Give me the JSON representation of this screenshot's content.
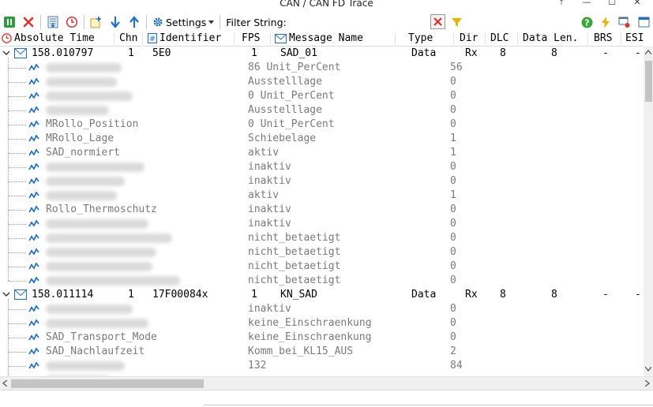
{
  "window": {
    "title": "CAN / CAN FD Trace",
    "buttons": [
      "⤒",
      "—",
      "☐",
      "✕"
    ]
  },
  "toolbar": {
    "settings_label": "Settings",
    "filter_label": "Filter String:",
    "filter_value": ""
  },
  "columns": {
    "time": "Absolute Time",
    "chn": "Chn",
    "identifier": "Identifier",
    "fps": "FPS",
    "message_name": "Message Name",
    "type": "Type",
    "dir": "Dir",
    "dlc": "DLC",
    "data_len": "Data Len.",
    "brs": "BRS",
    "esi": "ESI"
  },
  "messages": [
    {
      "time": "158.010797",
      "chn": "1",
      "id": "5E0",
      "fps": "1",
      "name": "SAD_01",
      "type": "Data",
      "dir": "Rx",
      "dlc": "8",
      "data_len": "8",
      "brs": "-",
      "esi": "-",
      "signals": [
        {
          "name": "",
          "value": "86 Unit_PerCent",
          "raw": "56",
          "blur": 96
        },
        {
          "name": "",
          "value": "Ausstelllage",
          "raw": "0",
          "blur": 90
        },
        {
          "name": "",
          "value": "0 Unit_PerCent",
          "raw": "0",
          "blur": 110
        },
        {
          "name": "",
          "value": "Ausstelllage",
          "raw": "0",
          "blur": 80
        },
        {
          "name": "MRollo_Position",
          "value": "0 Unit_PerCent",
          "raw": "0",
          "blur": 0
        },
        {
          "name": "MRollo_Lage",
          "value": "Schiebelage",
          "raw": "1",
          "blur": 0
        },
        {
          "name": "SAD_normiert",
          "value": "aktiv",
          "raw": "1",
          "blur": 0
        },
        {
          "name": "",
          "value": "inaktiv",
          "raw": "0",
          "blur": 125
        },
        {
          "name": "",
          "value": "inaktiv",
          "raw": "0",
          "blur": 100
        },
        {
          "name": "",
          "value": "aktiv",
          "raw": "1",
          "blur": 90
        },
        {
          "name": "Rollo_Thermoschutz",
          "value": "inaktiv",
          "raw": "0",
          "blur": 0
        },
        {
          "name": "",
          "value": "inaktiv",
          "raw": "0",
          "blur": 130
        },
        {
          "name": "",
          "value": "nicht_betaetigt",
          "raw": "0",
          "blur": 160
        },
        {
          "name": "",
          "value": "nicht_betaetigt",
          "raw": "0",
          "blur": 140
        },
        {
          "name": "",
          "value": "nicht_betaetigt",
          "raw": "0",
          "blur": 135
        },
        {
          "name": "",
          "value": "nicht_betaetigt",
          "raw": "0",
          "blur": 170
        }
      ]
    },
    {
      "time": "158.011114",
      "chn": "1",
      "id": "17F00084x",
      "fps": "1",
      "name": "KN_SAD",
      "type": "Data",
      "dir": "Rx",
      "dlc": "8",
      "data_len": "8",
      "brs": "-",
      "esi": "-",
      "signals": [
        {
          "name": "",
          "value": "inaktiv",
          "raw": "0",
          "blur": 110
        },
        {
          "name": "",
          "value": "keine_Einschraenkung",
          "raw": "0",
          "blur": 130
        },
        {
          "name": "SAD_Transport_Mode",
          "value": "keine_Einschraenkung",
          "raw": "0",
          "blur": 0
        },
        {
          "name": "SAD_Nachlaufzeit",
          "value": "Komm_bei_KL15_AUS",
          "raw": "2",
          "blur": 0
        },
        {
          "name": "",
          "value": "132",
          "raw": "84",
          "blur": 100
        },
        {
          "name": "",
          "value": "",
          "raw": "",
          "blur": 80
        }
      ]
    }
  ],
  "colors": {
    "accent_blue": "#1f6fc6",
    "stop_red": "#d9332b",
    "pause_green": "#2f9a3a",
    "help_green": "#3aa640",
    "bolt_yellow": "#e8b400"
  }
}
